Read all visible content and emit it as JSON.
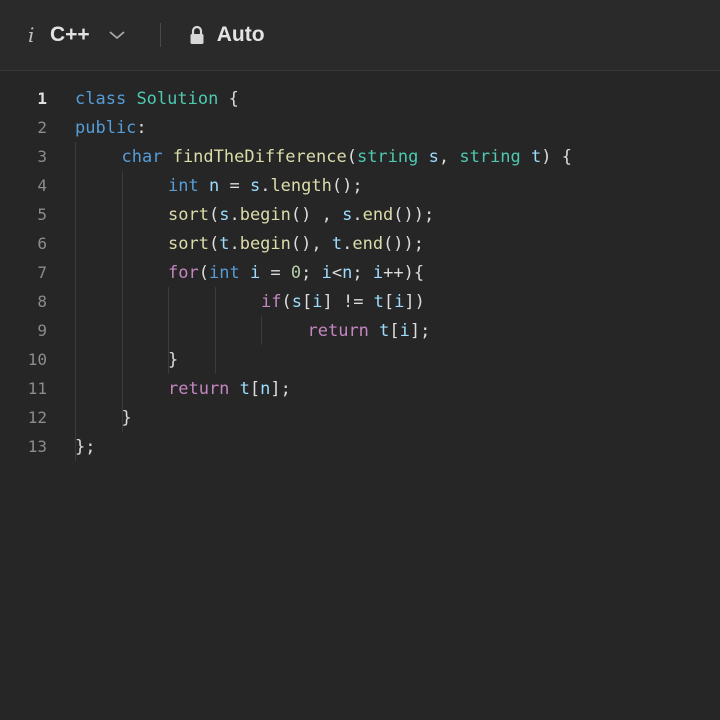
{
  "toolbar": {
    "info_icon": "i",
    "language": "C++",
    "mode": "Auto",
    "icons": [
      "info-icon",
      "chevron-down-icon",
      "lock-icon"
    ]
  },
  "editor": {
    "active_line": 1,
    "lines": [
      {
        "n": "1",
        "indent": 0,
        "tokens": [
          [
            "kw",
            "class"
          ],
          [
            "pl",
            " "
          ],
          [
            "ty",
            "Solution"
          ],
          [
            "pl",
            " {"
          ]
        ]
      },
      {
        "n": "2",
        "indent": 0,
        "tokens": [
          [
            "kw",
            "public"
          ],
          [
            "pl",
            ":"
          ]
        ]
      },
      {
        "n": "3",
        "indent": 1,
        "tokens": [
          [
            "kw",
            "char"
          ],
          [
            "pl",
            " "
          ],
          [
            "fn",
            "findTheDifference"
          ],
          [
            "pl",
            "("
          ],
          [
            "ty",
            "string"
          ],
          [
            "pl",
            " "
          ],
          [
            "var",
            "s"
          ],
          [
            "pl",
            ", "
          ],
          [
            "ty",
            "string"
          ],
          [
            "pl",
            " "
          ],
          [
            "var",
            "t"
          ],
          [
            "pl",
            ") {"
          ]
        ]
      },
      {
        "n": "4",
        "indent": 2,
        "tokens": [
          [
            "kw",
            "int"
          ],
          [
            "pl",
            " "
          ],
          [
            "var",
            "n"
          ],
          [
            "pl",
            " = "
          ],
          [
            "var",
            "s"
          ],
          [
            "pl",
            "."
          ],
          [
            "fn",
            "length"
          ],
          [
            "pl",
            "();"
          ]
        ]
      },
      {
        "n": "5",
        "indent": 2,
        "tokens": [
          [
            "fn",
            "sort"
          ],
          [
            "pl",
            "("
          ],
          [
            "var",
            "s"
          ],
          [
            "pl",
            "."
          ],
          [
            "fn",
            "begin"
          ],
          [
            "pl",
            "() , "
          ],
          [
            "var",
            "s"
          ],
          [
            "pl",
            "."
          ],
          [
            "fn",
            "end"
          ],
          [
            "pl",
            "());"
          ]
        ]
      },
      {
        "n": "6",
        "indent": 2,
        "tokens": [
          [
            "fn",
            "sort"
          ],
          [
            "pl",
            "("
          ],
          [
            "var",
            "t"
          ],
          [
            "pl",
            "."
          ],
          [
            "fn",
            "begin"
          ],
          [
            "pl",
            "(), "
          ],
          [
            "var",
            "t"
          ],
          [
            "pl",
            "."
          ],
          [
            "fn",
            "end"
          ],
          [
            "pl",
            "());"
          ]
        ]
      },
      {
        "n": "7",
        "indent": 2,
        "tokens": [
          [
            "ctl",
            "for"
          ],
          [
            "pl",
            "("
          ],
          [
            "kw",
            "int"
          ],
          [
            "pl",
            " "
          ],
          [
            "var",
            "i"
          ],
          [
            "pl",
            " = "
          ],
          [
            "num",
            "0"
          ],
          [
            "pl",
            "; "
          ],
          [
            "var",
            "i"
          ],
          [
            "pl",
            "<"
          ],
          [
            "var",
            "n"
          ],
          [
            "pl",
            "; "
          ],
          [
            "var",
            "i"
          ],
          [
            "pl",
            "++){"
          ]
        ]
      },
      {
        "n": "8",
        "indent": 4,
        "tokens": [
          [
            "ctl",
            "if"
          ],
          [
            "pl",
            "("
          ],
          [
            "var",
            "s"
          ],
          [
            "pl",
            "["
          ],
          [
            "var",
            "i"
          ],
          [
            "pl",
            "] != "
          ],
          [
            "var",
            "t"
          ],
          [
            "pl",
            "["
          ],
          [
            "var",
            "i"
          ],
          [
            "pl",
            "])"
          ]
        ]
      },
      {
        "n": "9",
        "indent": 5,
        "tokens": [
          [
            "ctl",
            "return"
          ],
          [
            "pl",
            " "
          ],
          [
            "var",
            "t"
          ],
          [
            "pl",
            "["
          ],
          [
            "var",
            "i"
          ],
          [
            "pl",
            "];"
          ]
        ]
      },
      {
        "n": "10",
        "indent": 2,
        "tokens": [
          [
            "pl",
            "}"
          ]
        ]
      },
      {
        "n": "11",
        "indent": 2,
        "tokens": [
          [
            "ctl",
            "return"
          ],
          [
            "pl",
            " "
          ],
          [
            "var",
            "t"
          ],
          [
            "pl",
            "["
          ],
          [
            "var",
            "n"
          ],
          [
            "pl",
            "];"
          ]
        ]
      },
      {
        "n": "12",
        "indent": 1,
        "tokens": [
          [
            "pl",
            "}"
          ]
        ]
      },
      {
        "n": "13",
        "indent": 0,
        "tokens": [
          [
            "pl",
            "};"
          ]
        ]
      }
    ]
  },
  "colors": {
    "background": "#262626",
    "keyword": "#569cd6",
    "control": "#c586c0",
    "type": "#4ec9b0",
    "function": "#dcdcaa",
    "variable": "#9cdcfe",
    "number": "#b5cea8"
  }
}
